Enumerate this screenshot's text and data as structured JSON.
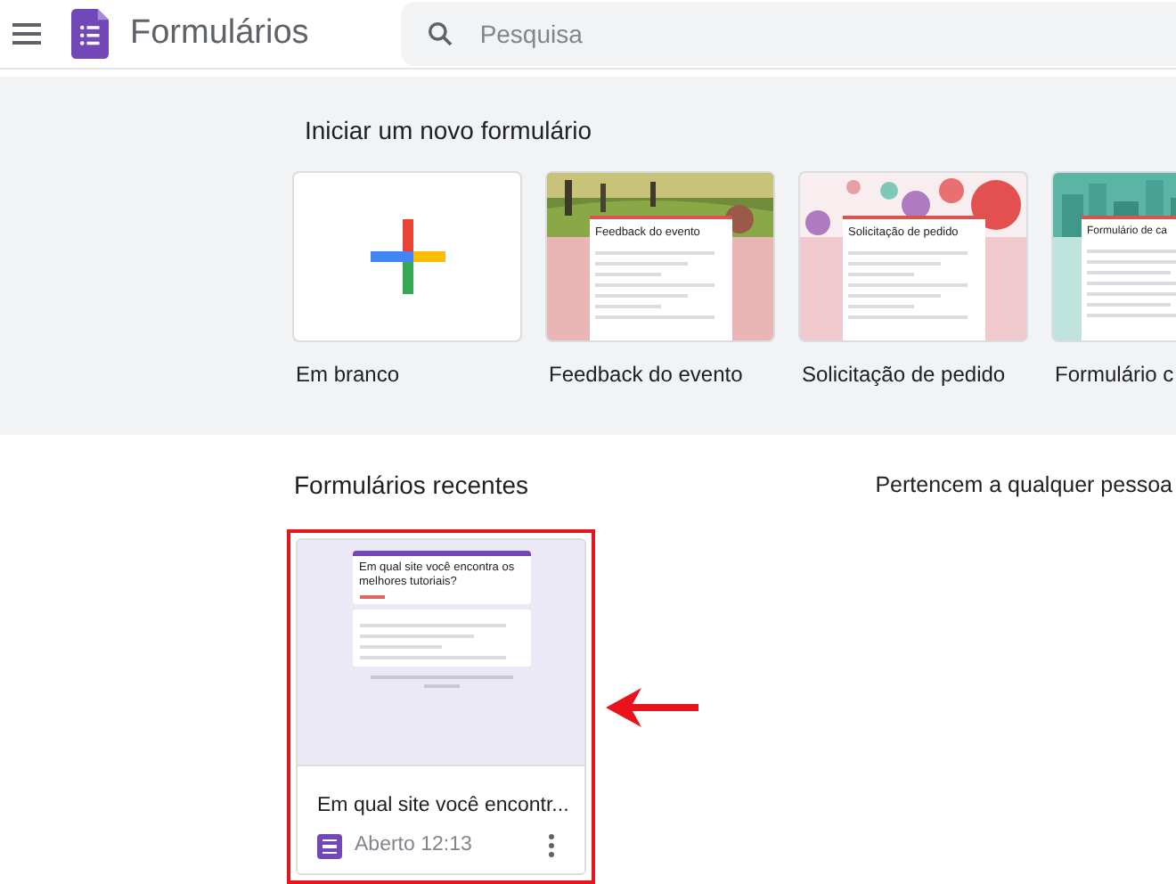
{
  "header": {
    "app_title": "Formulários",
    "search_placeholder": "Pesquisa"
  },
  "templates": {
    "heading": "Iniciar um novo formulário",
    "items": [
      {
        "kind": "blank",
        "label": "Em branco"
      },
      {
        "kind": "themed",
        "label": "Feedback do evento",
        "form_title": "Feedback do evento",
        "color": "#e9b5b5"
      },
      {
        "kind": "themed",
        "label": "Solicitação de pedido",
        "form_title": "Solicitação de pedido",
        "color": "#f0c9cf"
      },
      {
        "kind": "themed",
        "label": "Formulário c",
        "form_title": "Formulário de ca",
        "color": "#bfe3dd"
      }
    ]
  },
  "recent": {
    "heading": "Formulários recentes",
    "owner_filter": "Pertencem a qualquer pessoa",
    "items": [
      {
        "form_title": "Em qual site você encontra os melhores tutoriais?",
        "title": "Em qual site você encontr...",
        "opened": "Aberto 12:13"
      }
    ]
  }
}
